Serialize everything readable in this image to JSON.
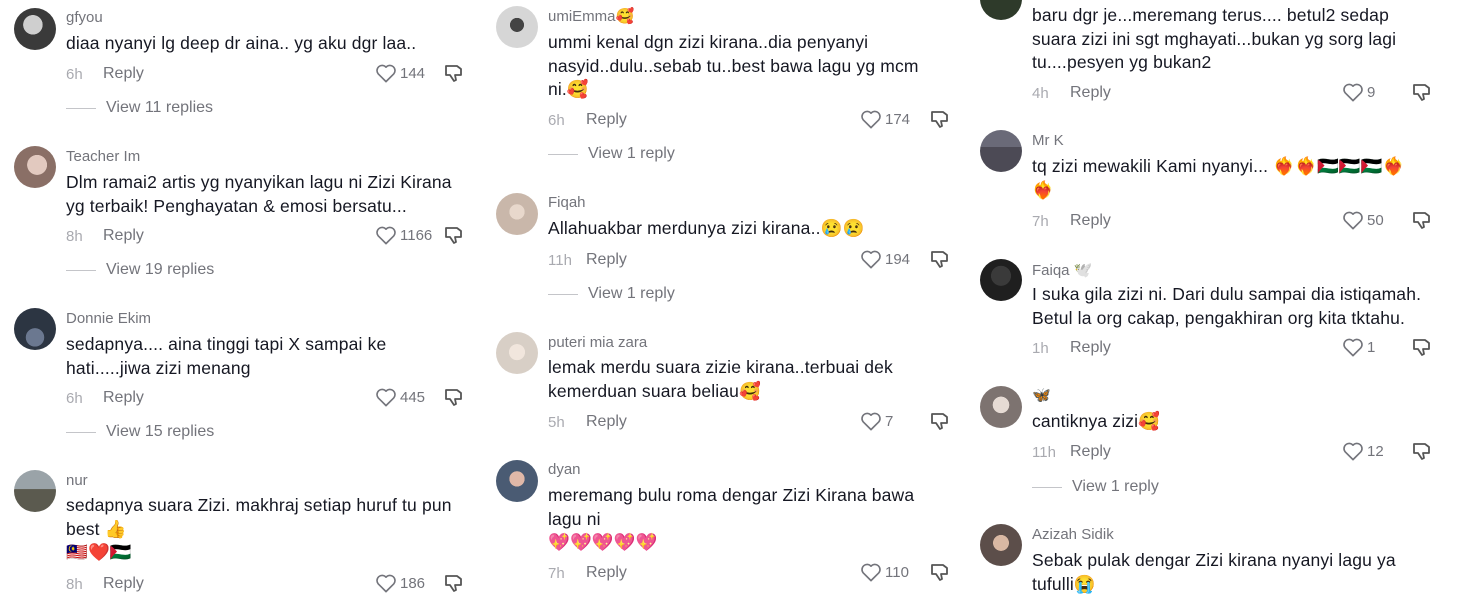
{
  "columns": [
    {
      "comments": [
        {
          "username": "gfyou",
          "text": "diaa nyanyi lg deep dr aina.. yg aku dgr laa..",
          "time": "6h",
          "reply": "Reply",
          "likes": "144",
          "view_replies": "View 11 replies",
          "avatar_color": "#3a3a3a"
        },
        {
          "username": "Teacher Im",
          "text": "Dlm ramai2 artis yg nyanyikan lagu ni Zizi Kirana\nyg terbaik! Penghayatan & emosi bersatu...",
          "time": "8h",
          "reply": "Reply",
          "likes": "1166",
          "view_replies": "View 19 replies",
          "avatar_color": "#8a6f66"
        },
        {
          "username": "Donnie Ekim",
          "text": "sedapnya.... aina tinggi tapi X sampai ke\nhati.....jiwa zizi menang",
          "time": "6h",
          "reply": "Reply",
          "likes": "445",
          "view_replies": "View 15 replies",
          "avatar_color": "#2c3542"
        },
        {
          "username": "nur",
          "text": "sedapnya suara Zizi. makhraj setiap huruf tu pun\nbest 👍\n🇲🇾❤️🇵🇸",
          "time": "8h",
          "reply": "Reply",
          "likes": "186",
          "view_replies": "",
          "avatar_color": "#5b5a4f"
        }
      ]
    },
    {
      "comments": [
        {
          "username": "umiEmma🥰",
          "text": "ummi kenal dgn zizi kirana..dia penyanyi\nnasyid..dulu..sebab tu..best bawa lagu yg mcm\nni.🥰",
          "time": "6h",
          "reply": "Reply",
          "likes": "174",
          "view_replies": "View 1 reply",
          "avatar_color": "#a9a9a9"
        },
        {
          "username": "Fiqah",
          "text": "Allahuakbar merdunya zizi kirana..😢😢",
          "time": "11h",
          "reply": "Reply",
          "likes": "194",
          "view_replies": "View 1 reply",
          "avatar_color": "#c9b7aa"
        },
        {
          "username": "puteri mia zara",
          "text": "lemak merdu suara zizie kirana..terbuai dek\nkemerduan suara beliau🥰",
          "time": "5h",
          "reply": "Reply",
          "likes": "7",
          "view_replies": "",
          "avatar_color": "#d8cfc6"
        },
        {
          "username": "dyan",
          "text": "meremang bulu roma dengar Zizi Kirana bawa\nlagu ni\n💖💖💖💖💖",
          "time": "7h",
          "reply": "Reply",
          "likes": "110",
          "view_replies": "",
          "avatar_color": "#4a5b73"
        }
      ]
    },
    {
      "comments": [
        {
          "username": "",
          "text": "baru dgr je...meremang terus.... betul2 sedap\nsuara zizi ini sgt mghayati...bukan yg sorg lagi\ntu....pesyen yg bukan2",
          "time": "4h",
          "reply": "Reply",
          "likes": "9",
          "view_replies": "",
          "avatar_color": "#2e3a2a"
        },
        {
          "username": "Mr K",
          "text": "tq zizi mewakili Kami nyanyi... ❤️‍🔥❤️‍🔥🇵🇸🇵🇸🇵🇸❤️‍🔥\n❤️‍🔥",
          "time": "7h",
          "reply": "Reply",
          "likes": "50",
          "view_replies": "",
          "avatar_color": "#4c4a55"
        },
        {
          "username": "Faiqa 🕊️",
          "text": "I suka gila zizi ni. Dari dulu sampai dia istiqamah.\nBetul la org cakap, pengakhiran org kita tktahu.",
          "time": "1h",
          "reply": "Reply",
          "likes": "1",
          "view_replies": "",
          "avatar_color": "#1f1f1f"
        },
        {
          "username": "🦋",
          "text": "cantiknya zizi🥰",
          "time": "11h",
          "reply": "Reply",
          "likes": "12",
          "view_replies": "View 1 reply",
          "avatar_color": "#7d7370"
        },
        {
          "username": "Azizah Sidik",
          "text": "Sebak pulak dengar Zizi kirana nyanyi lagu ya\ntufulli😭",
          "time": "",
          "reply": "",
          "likes": "",
          "view_replies": "",
          "avatar_color": "#5c4e4a"
        }
      ]
    }
  ],
  "icons": {
    "like": "heart-outline-icon",
    "dislike": "thumbs-down-icon"
  }
}
